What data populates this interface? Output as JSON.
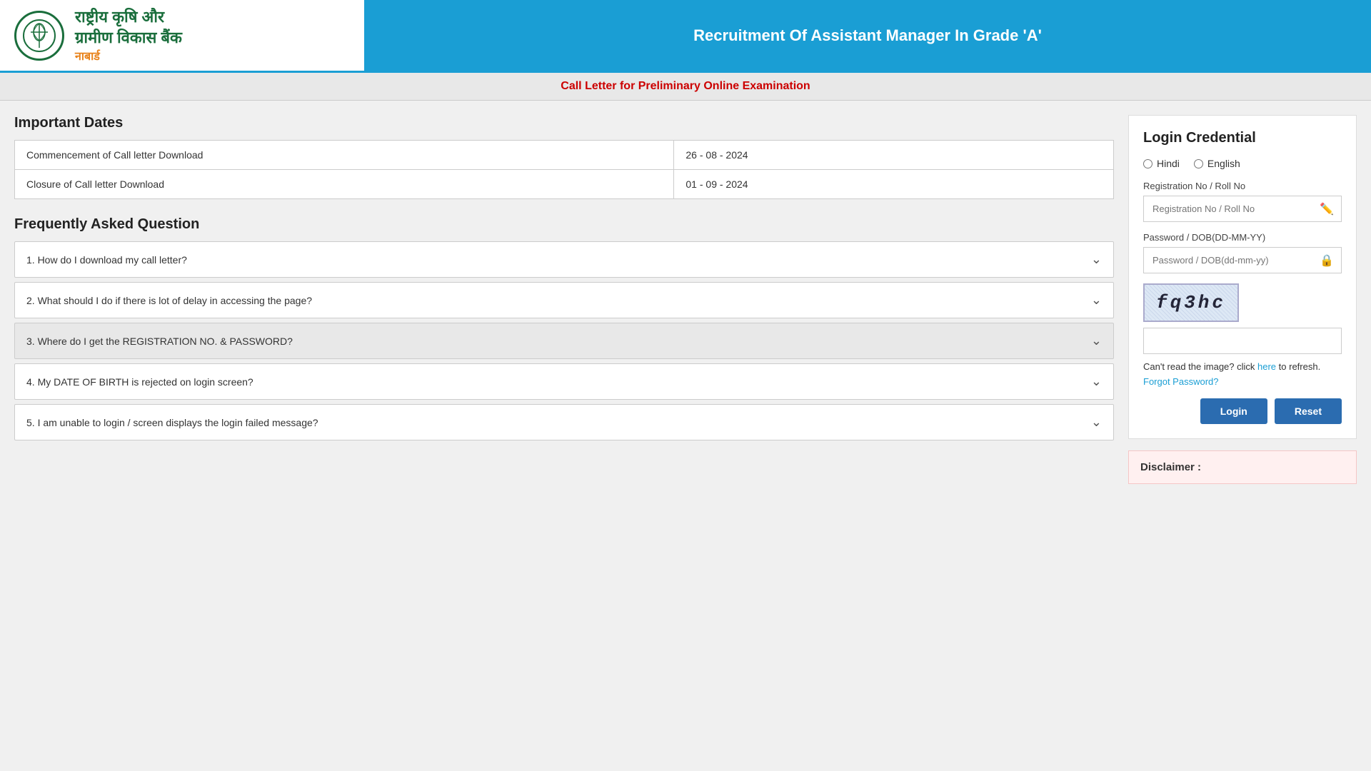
{
  "header": {
    "logo_hindi_line1": "राष्ट्रीय कृषि और",
    "logo_hindi_line2": "ग्रामीण विकास बैंक",
    "logo_nabard": "नाबार्ड",
    "title": "Recruitment Of Assistant Manager In Grade 'A'"
  },
  "subheader": {
    "text": "Call Letter for Preliminary Online Examination"
  },
  "important_dates": {
    "section_title": "Important Dates",
    "rows": [
      {
        "label": "Commencement of Call letter Download",
        "value": "26 - 08 - 2024"
      },
      {
        "label": "Closure of Call letter Download",
        "value": "01 - 09 - 2024"
      }
    ]
  },
  "faq": {
    "section_title": "Frequently Asked Question",
    "items": [
      {
        "text": "1. How do I download my call letter?",
        "active": false
      },
      {
        "text": "2. What should I do if there is lot of delay in accessing the page?",
        "active": false
      },
      {
        "text": "3. Where do I get the REGISTRATION NO. & PASSWORD?",
        "active": true
      },
      {
        "text": "4. My DATE OF BIRTH is rejected on login screen?",
        "active": false
      },
      {
        "text": "5. I am unable to login / screen displays the login failed message?",
        "active": false
      }
    ]
  },
  "login": {
    "title": "Login Credential",
    "lang_hindi": "Hindi",
    "lang_english": "English",
    "reg_no_label": "Registration No / Roll No",
    "reg_no_placeholder": "Registration No / Roll No",
    "password_label": "Password / DOB(DD-MM-YY)",
    "password_placeholder": "Password / DOB(dd-mm-yy)",
    "captcha_text": "fq3hc",
    "captcha_refresh_text": "Can't read the image? click ",
    "captcha_refresh_link": "here",
    "captcha_refresh_suffix": " to refresh.",
    "forgot_password": "Forgot Password?",
    "login_btn": "Login",
    "reset_btn": "Reset"
  },
  "disclaimer": {
    "title": "Disclaimer :"
  }
}
